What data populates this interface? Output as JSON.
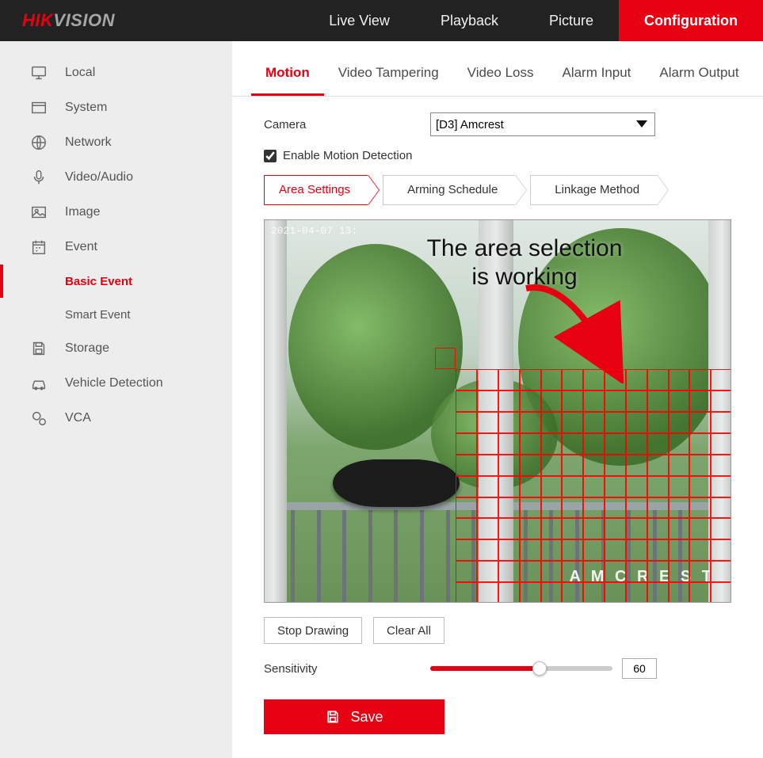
{
  "logo": {
    "hik": "HIK",
    "vision": "VISION"
  },
  "topnav": {
    "live_view": "Live View",
    "playback": "Playback",
    "picture": "Picture",
    "configuration": "Configuration"
  },
  "sidebar": {
    "local": "Local",
    "system": "System",
    "network": "Network",
    "video_audio": "Video/Audio",
    "image": "Image",
    "event": "Event",
    "basic_event": "Basic Event",
    "smart_event": "Smart Event",
    "storage": "Storage",
    "vehicle_detection": "Vehicle Detection",
    "vca": "VCA"
  },
  "subtabs": {
    "motion": "Motion",
    "video_tampering": "Video Tampering",
    "video_loss": "Video Loss",
    "alarm_input": "Alarm Input",
    "alarm_output": "Alarm Output"
  },
  "form": {
    "camera_label": "Camera",
    "camera_value": "[D3] Amcrest",
    "enable_motion_label": "Enable Motion Detection",
    "enable_motion_checked": true
  },
  "steptabs": {
    "area_settings": "Area Settings",
    "arming_schedule": "Arming Schedule",
    "linkage_method": "Linkage Method"
  },
  "preview": {
    "timestamp": "2021-04-07 13:",
    "annotation_line1": "The area selection",
    "annotation_line2": "is working",
    "brand_logo": "A M C R E S T"
  },
  "buttons": {
    "stop_drawing": "Stop Drawing",
    "clear_all": "Clear All",
    "save": "Save"
  },
  "sensitivity": {
    "label": "Sensitivity",
    "value": "60",
    "min": 0,
    "max": 100
  },
  "colors": {
    "accent": "#e60012"
  }
}
